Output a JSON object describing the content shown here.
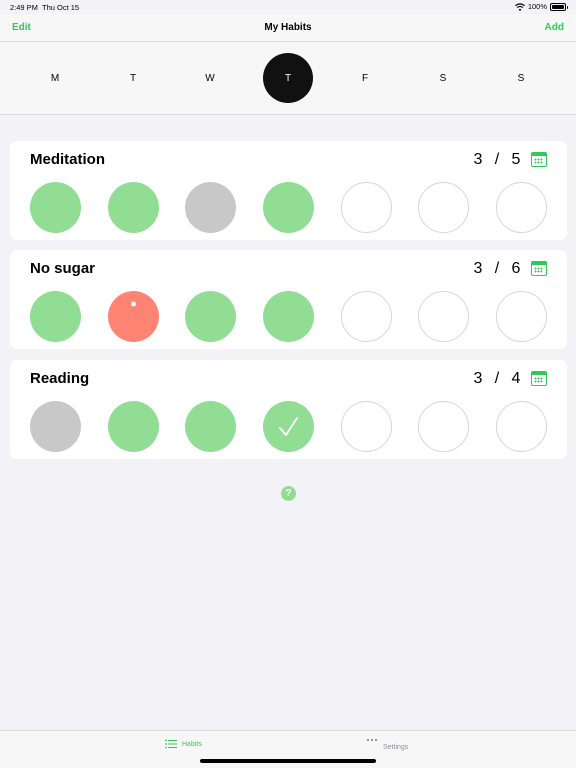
{
  "status": {
    "time": "2:49 PM",
    "date": "Thu Oct 15",
    "battery": "100%"
  },
  "nav": {
    "edit": "Edit",
    "title": "My Habits",
    "add": "Add"
  },
  "week": {
    "days": [
      "M",
      "T",
      "W",
      "T",
      "F",
      "S",
      "S"
    ],
    "selected_index": 3
  },
  "habits": [
    {
      "name": "Meditation",
      "done": "3",
      "sep": "/",
      "target": "5",
      "days": [
        "done",
        "done",
        "skip",
        "done",
        "empty",
        "empty",
        "empty"
      ]
    },
    {
      "name": "No sugar",
      "done": "3",
      "sep": "/",
      "target": "6",
      "days": [
        "done",
        "fail",
        "done",
        "done",
        "empty",
        "empty",
        "empty"
      ]
    },
    {
      "name": "Reading",
      "done": "3",
      "sep": "/",
      "target": "4",
      "days": [
        "skip",
        "done",
        "done",
        "done-check",
        "empty",
        "empty",
        "empty"
      ]
    }
  ],
  "help": "?",
  "tabs": {
    "habits": "Habits",
    "settings": "Settings"
  },
  "colors": {
    "accent": "#34c759",
    "done": "#91dd93",
    "skip": "#c8c8c8",
    "fail": "#ff8474"
  }
}
